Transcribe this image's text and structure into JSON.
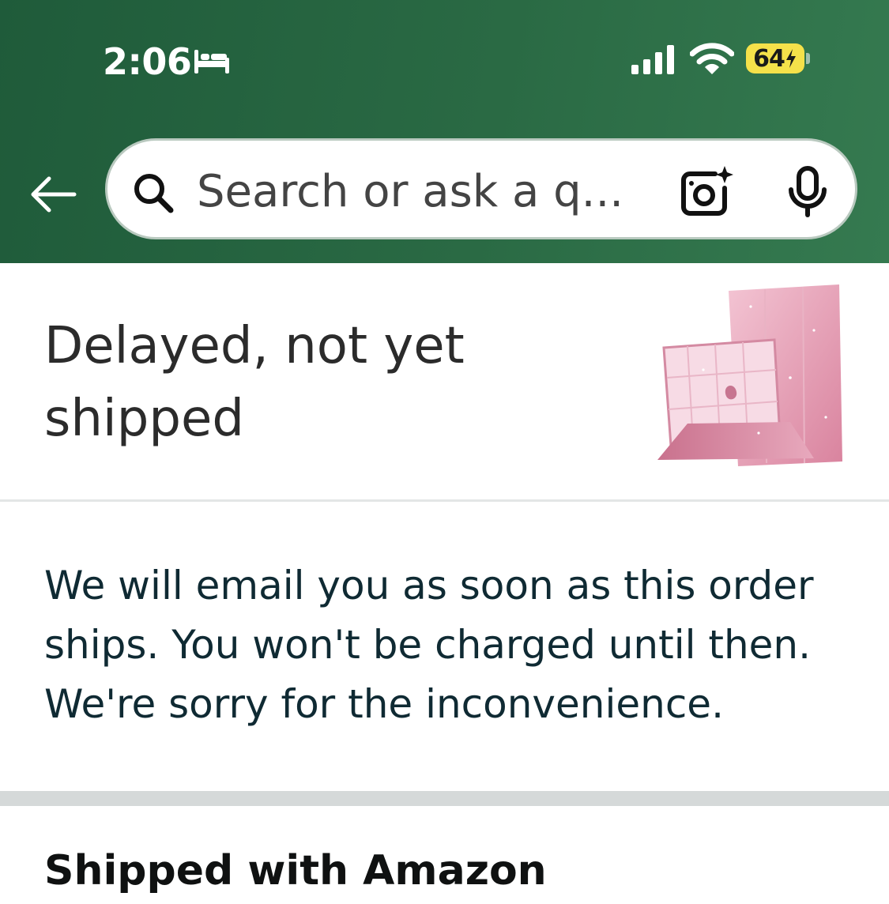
{
  "status_bar": {
    "time": "2:06",
    "battery_level": "64",
    "icons": [
      "bed-icon",
      "cellular-signal-icon",
      "wifi-icon",
      "battery-charging-icon"
    ]
  },
  "header": {
    "back_icon": "back-arrow-icon",
    "search": {
      "placeholder": "Search or ask a q...",
      "search_icon": "search-icon",
      "camera_icon": "camera-sparkle-icon",
      "mic_icon": "microphone-icon"
    }
  },
  "order_status": {
    "heading": "Delayed, not yet shipped",
    "product_image": "pink-glitter-tablet-case"
  },
  "message": "We will email you as soon as this order ships. You won't be charged until then. We're sorry for the inconvenience.",
  "shipping": {
    "heading": "Shipped with Amazon"
  },
  "colors": {
    "header_start": "#1f5b3a",
    "header_end": "#357a50",
    "battery_fill": "#f5e14a",
    "text_dark": "#0f1111",
    "divider": "#d5d9d9"
  }
}
